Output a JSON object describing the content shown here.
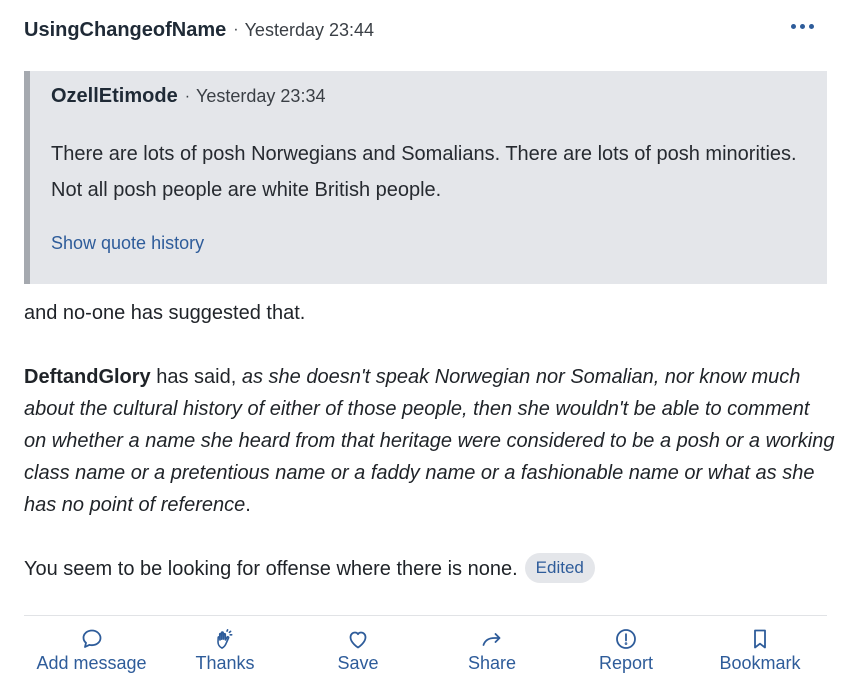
{
  "post": {
    "author": "UsingChangeofName",
    "separator": "·",
    "timestamp": "Yesterday 23:44",
    "more_icon": "ellipsis-horizontal-icon"
  },
  "quote": {
    "author": "OzellEtimode",
    "separator": "·",
    "timestamp": "Yesterday 23:34",
    "text": "There are lots of posh Norwegians and Somalians. There are lots of posh minorities. Not all posh people are white British people.",
    "show_history": "Show quote history"
  },
  "body": {
    "p1": "and no-one has suggested that.",
    "p2_name": "DeftandGlory",
    "p2_said": " has said, ",
    "p2_quote": "as she doesn't speak Norwegian nor Somalian, nor know much about the cultural history of either of those people, then she wouldn't be able to comment on whether a name she heard from that heritage were considered to be a posh or a working class name or a pretentious name or a faddy name or a fashionable name or what as she has no point of reference",
    "p2_end": ".",
    "p3": "You seem to be looking for offense where there is none.",
    "edited": "Edited"
  },
  "actions": [
    {
      "label": "Add message",
      "icon": "speech-bubble-icon"
    },
    {
      "label": "Thanks",
      "icon": "clapping-hands-icon"
    },
    {
      "label": "Save",
      "icon": "heart-icon"
    },
    {
      "label": "Share",
      "icon": "share-arrow-icon"
    },
    {
      "label": "Report",
      "icon": "alert-circle-icon"
    },
    {
      "label": "Bookmark",
      "icon": "bookmark-icon"
    }
  ],
  "colors": {
    "link": "#2e5c9a",
    "quote_bg": "#e4e6ea",
    "quote_border": "#a5a9af"
  }
}
